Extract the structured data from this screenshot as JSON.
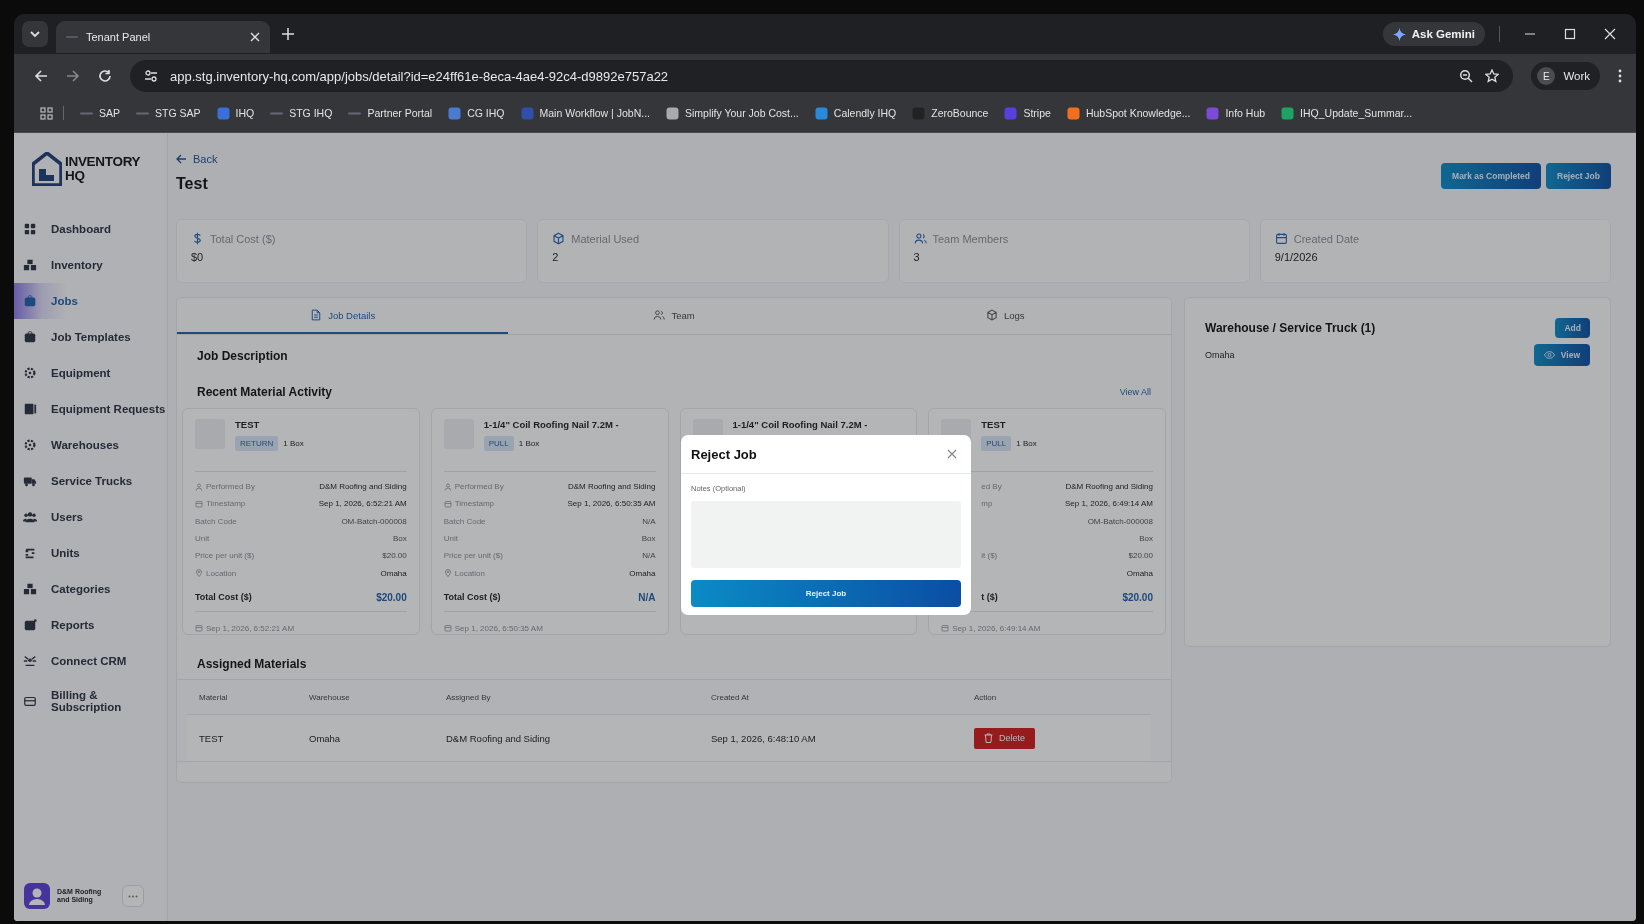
{
  "browser": {
    "tab_title": "Tenant Panel",
    "ask_button": "Ask Gemini",
    "url": "app.stg.inventory-hq.com/app/jobs/detail?id=e24ff61e-8eca-4ae4-92c4-d9892e757a22",
    "profile_initial": "E",
    "profile_name": "Work",
    "bookmarks": [
      "SAP",
      "STG SAP",
      "IHQ",
      "STG IHQ",
      "Partner Portal",
      "CG IHQ",
      "Main Workflow | JobN...",
      "Simplify Your Job Cost...",
      "Calendly IHQ",
      "ZeroBounce",
      "Stripe",
      "HubSpot Knowledge...",
      "Info Hub",
      "IHQ_Update_Summar..."
    ]
  },
  "sidebar": {
    "logo_line1": "INVENTORY",
    "logo_line2": "HQ",
    "items": [
      {
        "label": "Dashboard",
        "selected": false
      },
      {
        "label": "Inventory",
        "selected": false
      },
      {
        "label": "Jobs",
        "selected": true
      },
      {
        "label": "Job Templates",
        "selected": false
      },
      {
        "label": "Equipment",
        "selected": false
      },
      {
        "label": "Equipment Requests",
        "selected": false
      },
      {
        "label": "Warehouses",
        "selected": false
      },
      {
        "label": "Service Trucks",
        "selected": false
      },
      {
        "label": "Users",
        "selected": false
      },
      {
        "label": "Units",
        "selected": false
      },
      {
        "label": "Categories",
        "selected": false
      },
      {
        "label": "Reports",
        "selected": false
      },
      {
        "label": "Connect CRM",
        "selected": false
      },
      {
        "label": "Billing & Subscription",
        "selected": false
      }
    ],
    "user_name": "D&M Roofing and Siding"
  },
  "header": {
    "back": "Back",
    "title": "Test",
    "buttons": [
      "Mark as Completed",
      "Reject Job"
    ]
  },
  "stats": [
    {
      "label": "Total Cost ($)",
      "value": "$0"
    },
    {
      "label": "Material Used",
      "value": "2"
    },
    {
      "label": "Team Members",
      "value": "3"
    },
    {
      "label": "Created Date",
      "value": "9/1/2026"
    }
  ],
  "tabs": [
    {
      "label": "Job Details",
      "selected": true
    },
    {
      "label": "Team",
      "selected": false
    },
    {
      "label": "Logs",
      "selected": false
    }
  ],
  "job_description": {
    "heading": "Job Description"
  },
  "recent_activity": {
    "heading": "Recent Material Activity",
    "view_all": "View All",
    "cards": [
      {
        "kind": "full",
        "title": "TEST",
        "badge": "RETURN",
        "quantity": "1 Box",
        "rows": [
          {
            "label": "Performed By",
            "value": "D&M Roofing and Siding"
          },
          {
            "label": "Timestamp",
            "value": "Sep 1, 2026, 6:52:21 AM"
          },
          {
            "label": "Batch Code",
            "value": "OM-Batch-000008"
          },
          {
            "label": "Unit",
            "value": "Box"
          },
          {
            "label": "Price per unit ($)",
            "value": "$20.00"
          },
          {
            "label": "Location",
            "value": "Omaha"
          }
        ],
        "total_label": "Total Cost ($)",
        "total": "$20.00",
        "footer": "Sep 1, 2026, 6:52:21 AM"
      },
      {
        "kind": "full",
        "title": "1-1/4\" Coil Roofing Nail 7.2M -",
        "badge": "PULL",
        "quantity": "1 Box",
        "rows": [
          {
            "label": "Performed By",
            "value": "D&M Roofing and Siding"
          },
          {
            "label": "Timestamp",
            "value": "Sep 1, 2026, 6:50:35 AM"
          },
          {
            "label": "Batch Code",
            "value": "N/A"
          },
          {
            "label": "Unit",
            "value": "Box"
          },
          {
            "label": "Price per unit ($)",
            "value": "N/A"
          },
          {
            "label": "Location",
            "value": "Omaha"
          }
        ],
        "total_label": "Total Cost ($)",
        "total": "N/A",
        "footer": "Sep 1, 2026, 6:50:35 AM"
      },
      {
        "kind": "title_only",
        "title": "1-1/4\" Coil Roofing Nail 7.2M -"
      },
      {
        "kind": "right_part",
        "title": "TEST",
        "badge": "PULL",
        "quantity": "1 Box",
        "rows": [
          {
            "label": "ed By",
            "value": "D&M Roofing and Siding"
          },
          {
            "label": "mp",
            "value": "Sep 1, 2026, 6:49:14 AM"
          },
          {
            "value": "OM-Batch-000008"
          },
          {
            "value": "Box"
          },
          {
            "label": "it ($)",
            "value": "$20.00"
          },
          {
            "value": "Omaha"
          }
        ],
        "total_label": "t ($)",
        "total": "$20.00",
        "footer": "Sep 1, 2026, 6:49:14 AM"
      }
    ]
  },
  "assigned_materials": {
    "heading": "Assigned Materials",
    "columns": [
      "Material",
      "Warehouse",
      "Assigned By",
      "Created At",
      "Action"
    ],
    "rows": [
      {
        "cells": [
          "TEST",
          "Omaha",
          "D&M Roofing and Siding",
          "Sep 1, 2026, 6:48:10 AM"
        ],
        "action": "Delete"
      }
    ]
  },
  "warehouse_panel": {
    "heading": "Warehouse / Service Truck (1)",
    "add": "Add",
    "items": [
      {
        "name": "Omaha",
        "action": "View"
      }
    ]
  },
  "modal": {
    "title": "Reject Job",
    "notes_label": "Notes (Optional)",
    "submit": "Reject Job"
  }
}
